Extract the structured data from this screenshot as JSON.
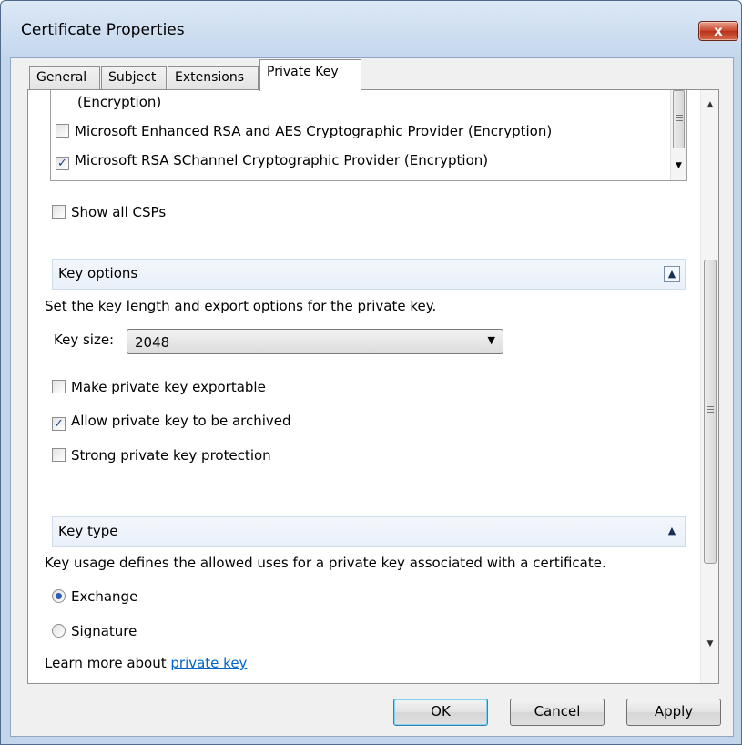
{
  "window": {
    "title": "Certificate Properties",
    "close_label": "x"
  },
  "tabs": [
    {
      "label": "General"
    },
    {
      "label": "Subject"
    },
    {
      "label": "Extensions"
    },
    {
      "label": "Private Key",
      "active": true
    }
  ],
  "csp": {
    "items": [
      {
        "label": "(Encryption)",
        "checked": false,
        "partial": true
      },
      {
        "label": "Microsoft Enhanced RSA and AES Cryptographic Provider (Encryption)",
        "checked": false
      },
      {
        "label": "Microsoft RSA SChannel Cryptographic Provider (Encryption)",
        "checked": true
      }
    ],
    "show_all_label": "Show all CSPs",
    "show_all_checked": false
  },
  "key_options": {
    "header": "Key options",
    "description": "Set the key length and export options for the private key.",
    "key_size_label": "Key size:",
    "key_size_value": "2048",
    "checkboxes": [
      {
        "label": "Make private key exportable",
        "checked": false
      },
      {
        "label": "Allow private key to be archived",
        "checked": true
      },
      {
        "label": "Strong private key protection",
        "checked": false
      }
    ]
  },
  "key_type": {
    "header": "Key type",
    "description": "Key usage defines the allowed uses for a private key associated with a certificate.",
    "options": [
      {
        "label": "Exchange",
        "selected": true
      },
      {
        "label": "Signature",
        "selected": false
      }
    ]
  },
  "footer": {
    "learn_more_prefix": "Learn more about ",
    "learn_more_link": "private key"
  },
  "buttons": {
    "ok": "OK",
    "cancel": "Cancel",
    "apply": "Apply"
  },
  "colors": {
    "title_bar": "#c4d7ee",
    "close_button": "#c9432a",
    "section_header": "#e9f0f9",
    "link": "#0066cc",
    "check_mark": "#1f3f8a"
  }
}
